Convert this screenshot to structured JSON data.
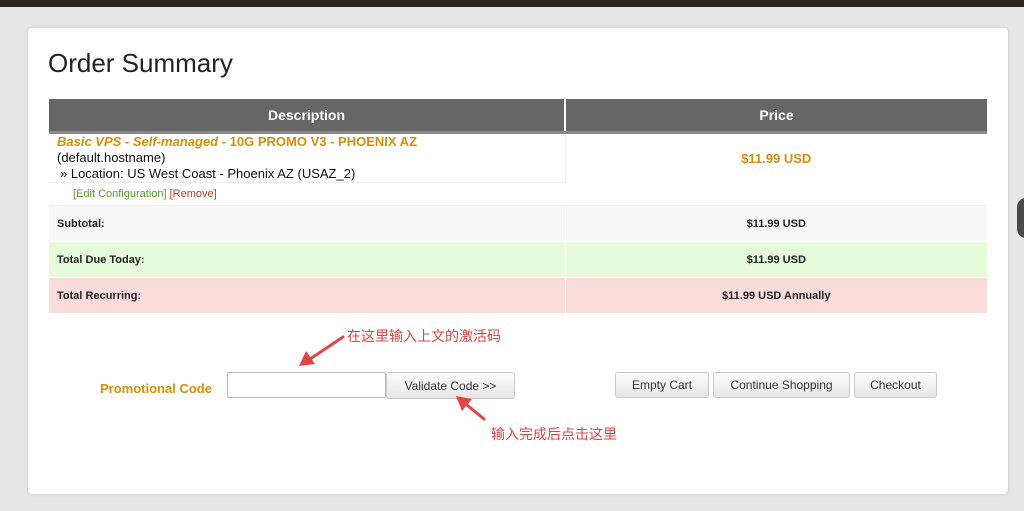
{
  "page": {
    "title": "Order Summary"
  },
  "table": {
    "headers": {
      "description": "Description",
      "price": "Price"
    }
  },
  "item": {
    "product_group": "Basic VPS - Self-managed",
    "product_name": " - 10G PROMO V3 - PHOENIX AZ",
    "hostname": "(default.hostname)",
    "location": "» Location: US West Coast - Phoenix AZ (USAZ_2)",
    "price": "$11.99 USD",
    "edit_link": "[Edit Configuration]",
    "remove_link": "[Remove]"
  },
  "totals": {
    "subtotal_label": "Subtotal:",
    "subtotal_value": "$11.99 USD",
    "due_today_label": "Total Due Today:",
    "due_today_value": "$11.99 USD",
    "recurring_label": "Total Recurring:",
    "recurring_value": "$11.99 USD Annually"
  },
  "promo": {
    "label": "Promotional Code",
    "value": "",
    "placeholder": "",
    "validate_label": "Validate Code >>"
  },
  "actions": {
    "empty_cart": "Empty Cart",
    "continue_shopping": "Continue Shopping",
    "checkout": "Checkout"
  },
  "annotations": {
    "promo_hint": "在这里输入上文的激活码",
    "validate_hint": "输入完成后点击这里"
  },
  "colors": {
    "accent_orange": "#d4900a",
    "header_gray": "#666666",
    "due_green": "#e5fbd9",
    "recurring_red": "#fbdcdc",
    "annotation_red": "#e24545"
  }
}
